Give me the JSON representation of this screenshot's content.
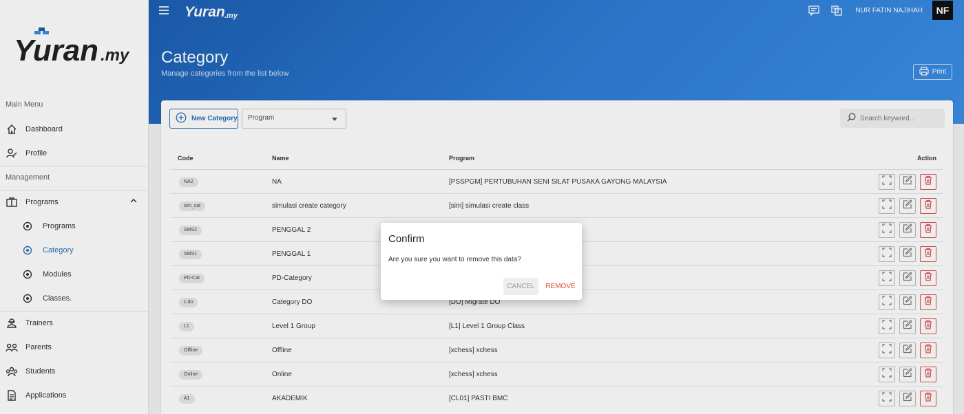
{
  "brand": {
    "logo_text": "Yuran",
    "logo_suffix": ".my"
  },
  "sidebar": {
    "sections": [
      "Main Menu",
      "Management"
    ],
    "items": [
      {
        "label": "Dashboard",
        "icon": "home-icon"
      },
      {
        "label": "Profile",
        "icon": "profile-icon"
      },
      {
        "label": "Programs",
        "icon": "programs-icon"
      },
      {
        "label": "Programs",
        "icon": "radio-icon"
      },
      {
        "label": "Category",
        "icon": "radio-icon"
      },
      {
        "label": "Modules",
        "icon": "radio-icon"
      },
      {
        "label": "Classes.",
        "icon": "radio-icon"
      },
      {
        "label": "Trainers",
        "icon": "trainers-icon"
      },
      {
        "label": "Parents",
        "icon": "parents-icon"
      },
      {
        "label": "Students",
        "icon": "students-icon"
      },
      {
        "label": "Applications",
        "icon": "document-icon"
      }
    ]
  },
  "header": {
    "user_name": "NUR FATIN NAJIHAH",
    "avatar_initials": "NF",
    "title": "Category",
    "subtitle": "Manage categories from the list below",
    "print_label": "Print"
  },
  "toolbar": {
    "new_label": "New Category",
    "program_placeholder": "Program",
    "search_placeholder": "Search keyword..."
  },
  "table": {
    "columns": [
      "Code",
      "Name",
      "Program",
      "Action"
    ],
    "rows": [
      {
        "code": "NA2",
        "name": "NA",
        "program": "[PSSPGM] PERTUBUHAN SENI SILAT PUSAKA GAYONG MALAYSIA"
      },
      {
        "code": "sim_cat",
        "name": "simulasi create category",
        "program": "[sim] simulasi create class"
      },
      {
        "code": "SMS2",
        "name": "PENGGAL 2",
        "program": ""
      },
      {
        "code": "SMS1",
        "name": "PENGGAL 1",
        "program": ""
      },
      {
        "code": "PD-Cat",
        "name": "PD-Category",
        "program": ""
      },
      {
        "code": "c.do",
        "name": "Category DO",
        "program": "[DO] Migrate DO"
      },
      {
        "code": "L1",
        "name": "Level 1 Group",
        "program": "[L1] Level 1 Group Class"
      },
      {
        "code": "Offline",
        "name": "Offline",
        "program": "[xchess] xchess"
      },
      {
        "code": "Online",
        "name": "Online",
        "program": "[xchess] xchess"
      },
      {
        "code": "A1",
        "name": "AKADEMIK",
        "program": "[CL01] PASTI BMC"
      }
    ]
  },
  "dialog": {
    "title": "Confirm",
    "message": "Are you sure you want to remove this data?",
    "cancel_label": "CANCEL",
    "remove_label": "REMOVE"
  },
  "colors": {
    "primary": "#2c6fb7",
    "danger": "#e0473b",
    "header_blue": "#2f7fd8"
  }
}
